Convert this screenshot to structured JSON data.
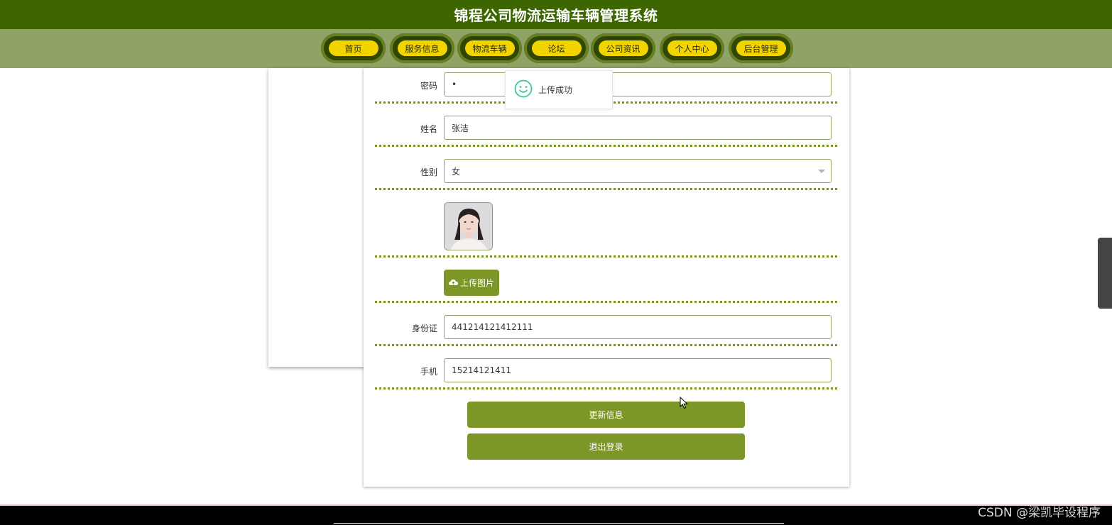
{
  "header": {
    "title": "锦程公司物流运输车辆管理系统"
  },
  "nav": {
    "items": [
      {
        "label": "首页"
      },
      {
        "label": "服务信息"
      },
      {
        "label": "物流车辆"
      },
      {
        "label": "论坛"
      },
      {
        "label": "公司资讯"
      },
      {
        "label": "个人中心"
      },
      {
        "label": "后台管理"
      }
    ]
  },
  "form": {
    "password": {
      "label": "密码",
      "value": "•"
    },
    "name": {
      "label": "姓名",
      "value": "张洁"
    },
    "gender": {
      "label": "性别",
      "value": "女"
    },
    "upload_button": "上传图片",
    "id_card": {
      "label": "身份证",
      "value": "441214121412111"
    },
    "phone": {
      "label": "手机",
      "value": "15214121411"
    },
    "update_button": "更新信息",
    "logout_button": "退出登录"
  },
  "toast": {
    "message": "上传成功"
  },
  "watermark": "CSDN @梁凯毕设程序",
  "colors": {
    "header_bg": "#3d6500",
    "nav_bg": "#8fa365",
    "nav_pill": "#f2d400",
    "button_bg": "#7d9628"
  }
}
